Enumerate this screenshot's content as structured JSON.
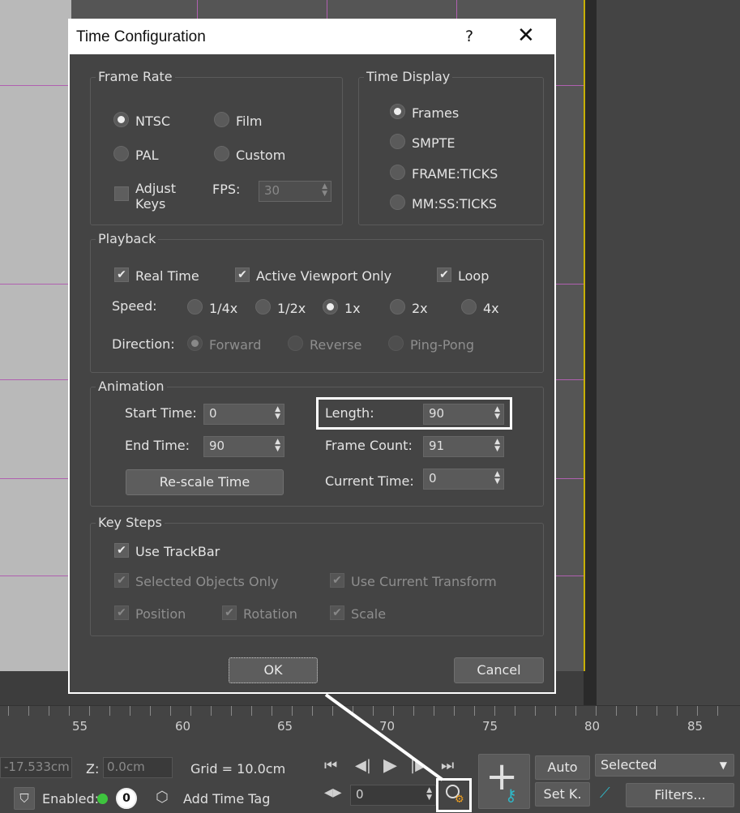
{
  "dialog": {
    "title": "Time Configuration",
    "help_label": "?",
    "close_label": "✕",
    "frame_rate": {
      "title": "Frame Rate",
      "ntsc": "NTSC",
      "film": "Film",
      "pal": "PAL",
      "custom": "Custom",
      "adjust_keys_line1": "Adjust",
      "adjust_keys_line2": "Keys",
      "fps_label": "FPS:",
      "fps_value": "30",
      "selected": "NTSC"
    },
    "time_display": {
      "title": "Time Display",
      "frames": "Frames",
      "smpte": "SMPTE",
      "frame_ticks": "FRAME:TICKS",
      "mm_ss_ticks": "MM:SS:TICKS",
      "selected": "Frames"
    },
    "playback": {
      "title": "Playback",
      "real_time": "Real Time",
      "active_viewport_only": "Active Viewport Only",
      "loop": "Loop",
      "speed_label": "Speed:",
      "speeds": [
        "1/4x",
        "1/2x",
        "1x",
        "2x",
        "4x"
      ],
      "selected_speed": "1x",
      "direction_label": "Direction:",
      "forward": "Forward",
      "reverse": "Reverse",
      "ping_pong": "Ping-Pong"
    },
    "animation": {
      "title": "Animation",
      "start_time_label": "Start Time:",
      "start_time_value": "0",
      "end_time_label": "End Time:",
      "end_time_value": "90",
      "rescale_label": "Re-scale Time",
      "length_label": "Length:",
      "length_value": "90",
      "frame_count_label": "Frame Count:",
      "frame_count_value": "91",
      "current_time_label": "Current Time:",
      "current_time_value": "0"
    },
    "key_steps": {
      "title": "Key Steps",
      "use_trackbar": "Use TrackBar",
      "selected_objects_only": "Selected Objects Only",
      "use_current_transform": "Use Current Transform",
      "position": "Position",
      "rotation": "Rotation",
      "scale": "Scale"
    },
    "ok_label": "OK",
    "cancel_label": "Cancel"
  },
  "ruler": {
    "labels": [
      "55",
      "60",
      "65",
      "70",
      "75",
      "80",
      "85"
    ]
  },
  "statusbar": {
    "x_value": "-17.533cm",
    "z_label": "Z:",
    "z_value": "0.0cm",
    "grid_text": "Grid = 10.0cm",
    "enabled_label": "Enabled:",
    "counter_value": "0",
    "add_time_tag": "Add Time Tag",
    "frame_value": "0",
    "auto_label": "Auto",
    "set_key_label": "Set K.",
    "selected_dropdown": "Selected",
    "filters_label": "Filters..."
  },
  "colors": {
    "accent_highlight": "#ffffff",
    "enabled_dot": "#3ec43e",
    "time_config_icon": "#f0a020"
  }
}
